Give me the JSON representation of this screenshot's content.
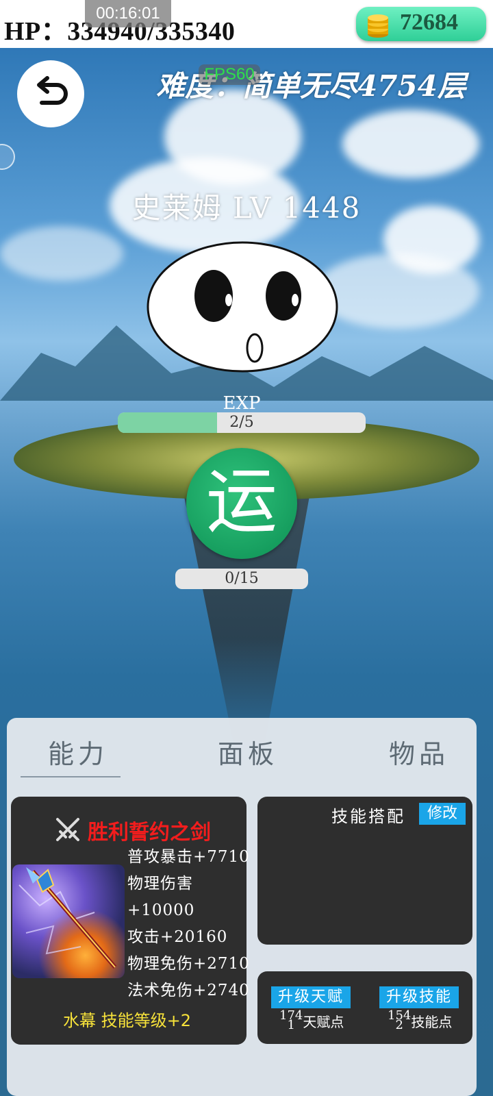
{
  "header": {
    "hp_text": "HP：334940/335340",
    "timer": "00:16:01",
    "gold": "72684"
  },
  "scene": {
    "level_title": "难度：简单无尽4754层",
    "fps": "FPS60",
    "monster_name": "史莱姆 LV 1448",
    "exp_label": "EXP",
    "exp_text": "2/5",
    "exp_fraction": 0.4,
    "yun_label": "运",
    "yun_text": "0/15",
    "yun_fraction": 0.0
  },
  "tabs": [
    {
      "label": "能力"
    },
    {
      "label": "面板"
    },
    {
      "label": "物品"
    }
  ],
  "weapon": {
    "name": "胜利誓约之剑",
    "stats": [
      "普攻暴击+7710",
      "物理伤害",
      "+10000",
      "攻击+20160",
      "物理免伤+2710",
      "法术免伤+2740"
    ],
    "extra": "水幕 技能等级+2"
  },
  "skills": {
    "title": "技能搭配",
    "modify_label": "修改"
  },
  "upgrades": {
    "talent_button": "升级天赋",
    "talent_points_top": "174",
    "talent_points_bottom": "1",
    "talent_points_label": "天赋点",
    "skill_button": "升级技能",
    "skill_points_top": "154",
    "skill_points_bottom": "2",
    "skill_points_label": "技能点"
  },
  "icons": {
    "back": "back-arrow-icon",
    "coin": "coin-stack-icon",
    "swords": "crossed-swords-icon"
  },
  "colors": {
    "coin_badge": "#2fcf97",
    "weapon_name": "#f21d1d",
    "weapon_extra": "#f7e23a",
    "action_button": "#1aa5e8",
    "exp_fill": "#7dd3a4",
    "yun_button": "#0c8f53"
  }
}
